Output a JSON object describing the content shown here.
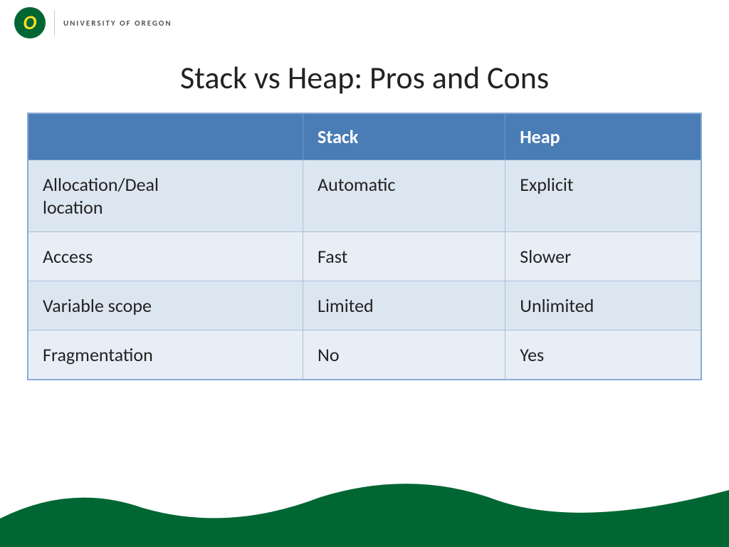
{
  "header": {
    "logo_letter": "O",
    "university_name": "UNIVERSITY OF OREGON"
  },
  "page_title": "Stack vs Heap: Pros and Cons",
  "table": {
    "columns": {
      "col1_header": "",
      "col2_header": "Stack",
      "col3_header": "Heap"
    },
    "rows": [
      {
        "label": "Allocation/Deallocation",
        "stack_value": "Automatic",
        "heap_value": "Explicit"
      },
      {
        "label": "Access",
        "stack_value": "Fast",
        "heap_value": "Slower"
      },
      {
        "label": "Variable scope",
        "stack_value": "Limited",
        "heap_value": "Unlimited"
      },
      {
        "label": "Fragmentation",
        "stack_value": "No",
        "heap_value": "Yes"
      }
    ]
  },
  "colors": {
    "uo_green": "#006633",
    "uo_yellow": "#FEE123",
    "header_blue": "#4a7cb5",
    "row_odd": "#dce6f1",
    "row_even": "#e8eef6"
  }
}
